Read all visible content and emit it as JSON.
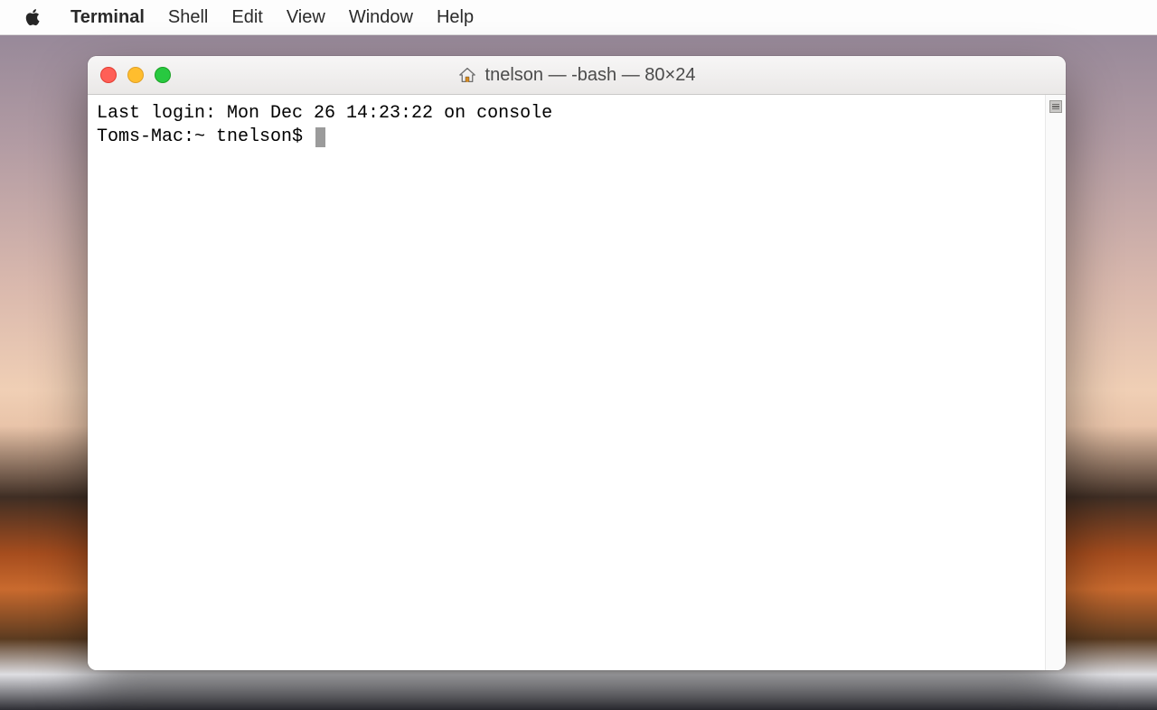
{
  "menubar": {
    "app_name": "Terminal",
    "items": [
      "Shell",
      "Edit",
      "View",
      "Window",
      "Help"
    ]
  },
  "window": {
    "title": "tnelson — -bash — 80×24",
    "proxy_icon": "home-icon"
  },
  "terminal": {
    "last_login_line": "Last login: Mon Dec 26 14:23:22 on console",
    "prompt": "Toms-Mac:~ tnelson$ "
  }
}
